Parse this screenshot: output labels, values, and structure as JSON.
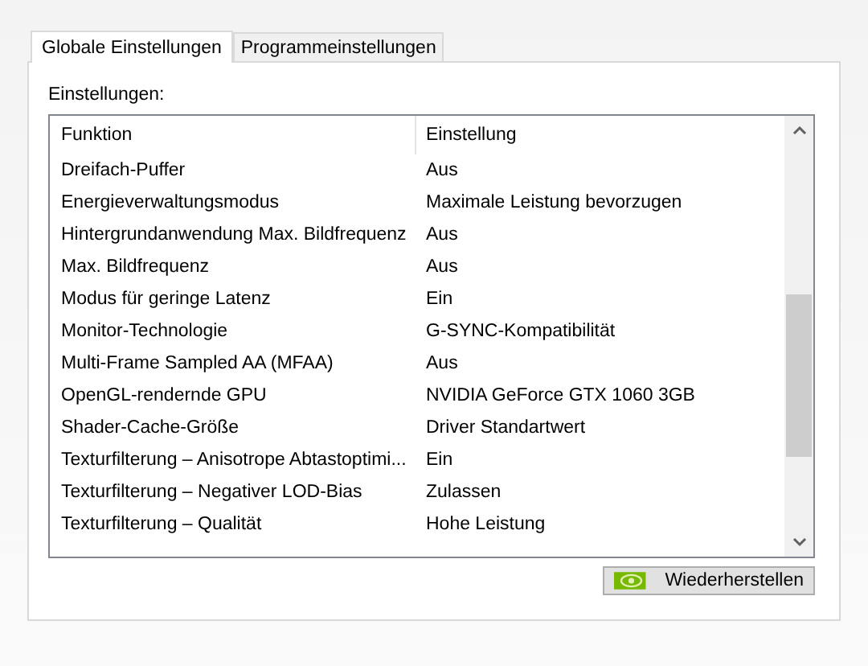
{
  "tabs": [
    {
      "label": "Globale Einstellungen",
      "selected": true
    },
    {
      "label": "Programmeinstellungen",
      "selected": false
    }
  ],
  "settings_label": "Einstellungen:",
  "table": {
    "columns": [
      "Funktion",
      "Einstellung"
    ],
    "rows": [
      {
        "function": "Dreifach-Puffer",
        "setting": "Aus"
      },
      {
        "function": "Energieverwaltungsmodus",
        "setting": "Maximale Leistung bevorzugen"
      },
      {
        "function": "Hintergrundanwendung Max. Bildfrequenz",
        "setting": "Aus"
      },
      {
        "function": "Max. Bildfrequenz",
        "setting": "Aus"
      },
      {
        "function": "Modus für geringe Latenz",
        "setting": "Ein"
      },
      {
        "function": "Monitor-Technologie",
        "setting": "G-SYNC-Kompatibilität"
      },
      {
        "function": "Multi-Frame Sampled AA (MFAA)",
        "setting": "Aus"
      },
      {
        "function": "OpenGL-rendernde GPU",
        "setting": "NVIDIA GeForce GTX 1060 3GB"
      },
      {
        "function": "Shader-Cache-Größe",
        "setting": "Driver Standartwert"
      },
      {
        "function": "Texturfilterung – Anisotrope Abtastoptimi...",
        "setting": "Ein"
      },
      {
        "function": "Texturfilterung – Negativer LOD-Bias",
        "setting": "Zulassen"
      },
      {
        "function": "Texturfilterung – Qualität",
        "setting": "Hohe Leistung"
      }
    ]
  },
  "restore_button": "Wiederherstellen"
}
